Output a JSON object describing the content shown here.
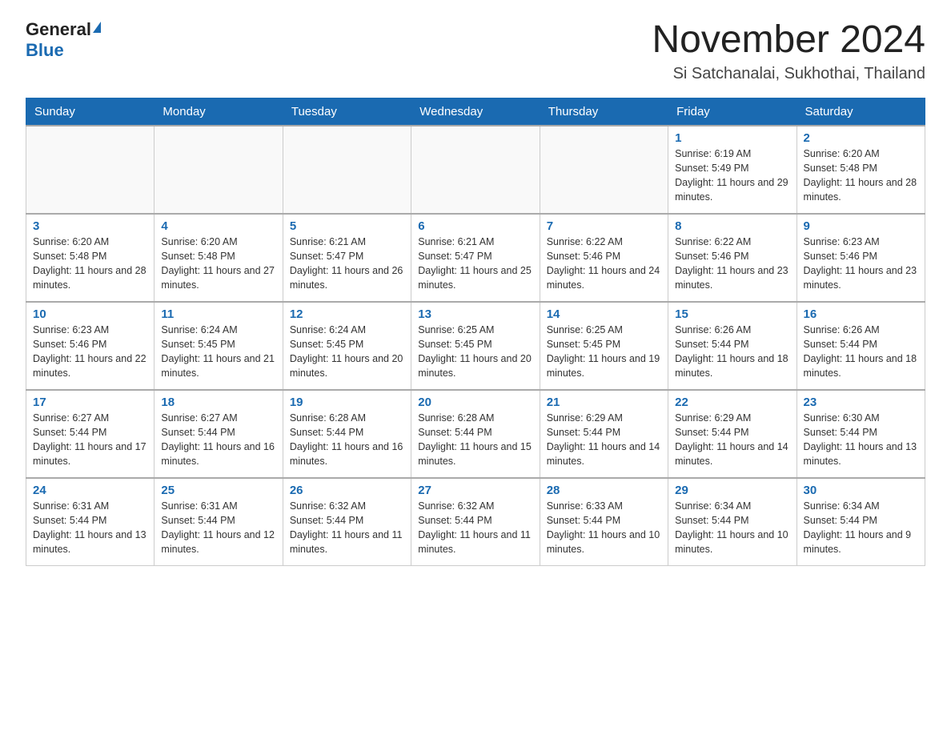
{
  "logo": {
    "general": "General",
    "blue": "Blue"
  },
  "title": "November 2024",
  "subtitle": "Si Satchanalai, Sukhothai, Thailand",
  "headers": [
    "Sunday",
    "Monday",
    "Tuesday",
    "Wednesday",
    "Thursday",
    "Friday",
    "Saturday"
  ],
  "weeks": [
    [
      {
        "day": "",
        "info": ""
      },
      {
        "day": "",
        "info": ""
      },
      {
        "day": "",
        "info": ""
      },
      {
        "day": "",
        "info": ""
      },
      {
        "day": "",
        "info": ""
      },
      {
        "day": "1",
        "info": "Sunrise: 6:19 AM\nSunset: 5:49 PM\nDaylight: 11 hours and 29 minutes."
      },
      {
        "day": "2",
        "info": "Sunrise: 6:20 AM\nSunset: 5:48 PM\nDaylight: 11 hours and 28 minutes."
      }
    ],
    [
      {
        "day": "3",
        "info": "Sunrise: 6:20 AM\nSunset: 5:48 PM\nDaylight: 11 hours and 28 minutes."
      },
      {
        "day": "4",
        "info": "Sunrise: 6:20 AM\nSunset: 5:48 PM\nDaylight: 11 hours and 27 minutes."
      },
      {
        "day": "5",
        "info": "Sunrise: 6:21 AM\nSunset: 5:47 PM\nDaylight: 11 hours and 26 minutes."
      },
      {
        "day": "6",
        "info": "Sunrise: 6:21 AM\nSunset: 5:47 PM\nDaylight: 11 hours and 25 minutes."
      },
      {
        "day": "7",
        "info": "Sunrise: 6:22 AM\nSunset: 5:46 PM\nDaylight: 11 hours and 24 minutes."
      },
      {
        "day": "8",
        "info": "Sunrise: 6:22 AM\nSunset: 5:46 PM\nDaylight: 11 hours and 23 minutes."
      },
      {
        "day": "9",
        "info": "Sunrise: 6:23 AM\nSunset: 5:46 PM\nDaylight: 11 hours and 23 minutes."
      }
    ],
    [
      {
        "day": "10",
        "info": "Sunrise: 6:23 AM\nSunset: 5:46 PM\nDaylight: 11 hours and 22 minutes."
      },
      {
        "day": "11",
        "info": "Sunrise: 6:24 AM\nSunset: 5:45 PM\nDaylight: 11 hours and 21 minutes."
      },
      {
        "day": "12",
        "info": "Sunrise: 6:24 AM\nSunset: 5:45 PM\nDaylight: 11 hours and 20 minutes."
      },
      {
        "day": "13",
        "info": "Sunrise: 6:25 AM\nSunset: 5:45 PM\nDaylight: 11 hours and 20 minutes."
      },
      {
        "day": "14",
        "info": "Sunrise: 6:25 AM\nSunset: 5:45 PM\nDaylight: 11 hours and 19 minutes."
      },
      {
        "day": "15",
        "info": "Sunrise: 6:26 AM\nSunset: 5:44 PM\nDaylight: 11 hours and 18 minutes."
      },
      {
        "day": "16",
        "info": "Sunrise: 6:26 AM\nSunset: 5:44 PM\nDaylight: 11 hours and 18 minutes."
      }
    ],
    [
      {
        "day": "17",
        "info": "Sunrise: 6:27 AM\nSunset: 5:44 PM\nDaylight: 11 hours and 17 minutes."
      },
      {
        "day": "18",
        "info": "Sunrise: 6:27 AM\nSunset: 5:44 PM\nDaylight: 11 hours and 16 minutes."
      },
      {
        "day": "19",
        "info": "Sunrise: 6:28 AM\nSunset: 5:44 PM\nDaylight: 11 hours and 16 minutes."
      },
      {
        "day": "20",
        "info": "Sunrise: 6:28 AM\nSunset: 5:44 PM\nDaylight: 11 hours and 15 minutes."
      },
      {
        "day": "21",
        "info": "Sunrise: 6:29 AM\nSunset: 5:44 PM\nDaylight: 11 hours and 14 minutes."
      },
      {
        "day": "22",
        "info": "Sunrise: 6:29 AM\nSunset: 5:44 PM\nDaylight: 11 hours and 14 minutes."
      },
      {
        "day": "23",
        "info": "Sunrise: 6:30 AM\nSunset: 5:44 PM\nDaylight: 11 hours and 13 minutes."
      }
    ],
    [
      {
        "day": "24",
        "info": "Sunrise: 6:31 AM\nSunset: 5:44 PM\nDaylight: 11 hours and 13 minutes."
      },
      {
        "day": "25",
        "info": "Sunrise: 6:31 AM\nSunset: 5:44 PM\nDaylight: 11 hours and 12 minutes."
      },
      {
        "day": "26",
        "info": "Sunrise: 6:32 AM\nSunset: 5:44 PM\nDaylight: 11 hours and 11 minutes."
      },
      {
        "day": "27",
        "info": "Sunrise: 6:32 AM\nSunset: 5:44 PM\nDaylight: 11 hours and 11 minutes."
      },
      {
        "day": "28",
        "info": "Sunrise: 6:33 AM\nSunset: 5:44 PM\nDaylight: 11 hours and 10 minutes."
      },
      {
        "day": "29",
        "info": "Sunrise: 6:34 AM\nSunset: 5:44 PM\nDaylight: 11 hours and 10 minutes."
      },
      {
        "day": "30",
        "info": "Sunrise: 6:34 AM\nSunset: 5:44 PM\nDaylight: 11 hours and 9 minutes."
      }
    ]
  ]
}
